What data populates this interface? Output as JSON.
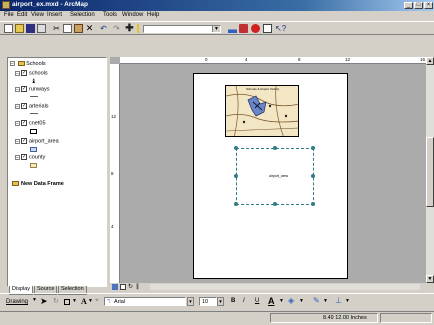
{
  "window": {
    "title": "airport_ex.mxd - ArcMap"
  },
  "menu": [
    "File",
    "Edit",
    "View",
    "Insert",
    "Selection",
    "Tools",
    "Window",
    "Help"
  ],
  "toolbar": {
    "scale_value": ""
  },
  "toc": {
    "data_frame": "Schools",
    "layers": [
      {
        "name": "schools"
      },
      {
        "name": "runways"
      },
      {
        "name": "arterials"
      },
      {
        "name": "cnet05"
      },
      {
        "name": "airport_area"
      },
      {
        "name": "county"
      }
    ],
    "new_data_frame": "New Data Frame"
  },
  "toc_tabs": [
    "Display",
    "Source",
    "Selection"
  ],
  "rulers": {
    "h_ticks": [
      "0",
      "4",
      "8",
      "12",
      "16"
    ],
    "v_ticks": [
      "12",
      "8",
      "4"
    ]
  },
  "map": {
    "title_label": "Schools & Airport Vicinity",
    "empty_frame_label": "airport_area"
  },
  "draw_toolbar": {
    "drawing_label": "Drawing",
    "font_name": "Arial",
    "font_size": "10",
    "bold": "B",
    "italic": "I",
    "underline": "U"
  },
  "status": {
    "coords": "8.49  12.00 Inches"
  },
  "colors": {
    "titlebar": "#0a246a",
    "selection": "#2e7d87",
    "map_bg": "#f3e6c4"
  }
}
